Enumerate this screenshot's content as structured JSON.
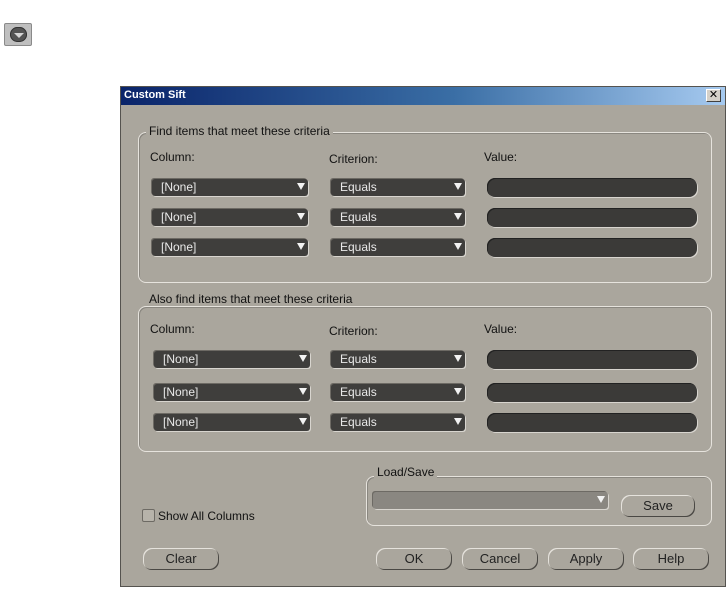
{
  "window": {
    "title": "Custom Sift",
    "close_glyph": "✕"
  },
  "top_widget": {
    "icon": "chevron-down-icon"
  },
  "group1": {
    "legend": "Find items that meet these criteria",
    "column_header": "Column:",
    "criterion_header": "Criterion:",
    "value_header": "Value:",
    "rows": [
      {
        "column": "[None]",
        "criterion": "Equals",
        "value": ""
      },
      {
        "column": "[None]",
        "criterion": "Equals",
        "value": ""
      },
      {
        "column": "[None]",
        "criterion": "Equals",
        "value": ""
      }
    ]
  },
  "group2": {
    "legend": "Also find items that meet these criteria",
    "column_header": "Column:",
    "criterion_header": "Criterion:",
    "value_header": "Value:",
    "rows": [
      {
        "column": "[None]",
        "criterion": "Equals",
        "value": ""
      },
      {
        "column": "[None]",
        "criterion": "Equals",
        "value": ""
      },
      {
        "column": "[None]",
        "criterion": "Equals",
        "value": ""
      }
    ]
  },
  "show_all_columns": {
    "label": "Show All Columns",
    "checked": false
  },
  "load_save": {
    "legend": "Load/Save",
    "selected": "",
    "save_label": "Save"
  },
  "buttons": {
    "clear": "Clear",
    "ok": "OK",
    "cancel": "Cancel",
    "apply": "Apply",
    "help": "Help"
  }
}
